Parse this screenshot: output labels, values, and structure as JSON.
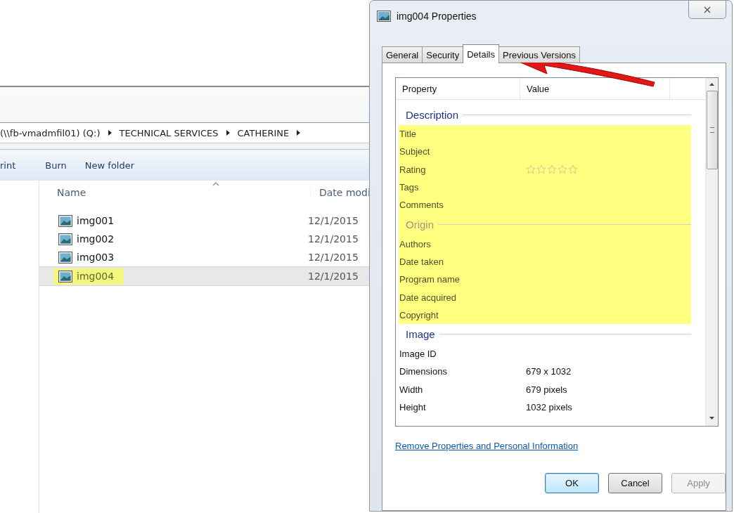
{
  "explorer": {
    "breadcrumb": [
      {
        "label": "(\\\\fb-vmadmfil01) (Q:)"
      },
      {
        "label": "TECHNICAL SERVICES"
      },
      {
        "label": "CATHERINE"
      }
    ],
    "toolbar": [
      "rint",
      "Burn",
      "New folder"
    ],
    "columns": [
      "Name",
      "Date modi"
    ],
    "files": [
      {
        "name": "img001",
        "date": "12/1/2015",
        "selected": false,
        "highlighted": false
      },
      {
        "name": "img002",
        "date": "12/1/2015",
        "selected": false,
        "highlighted": false
      },
      {
        "name": "img003",
        "date": "12/1/2015",
        "selected": false,
        "highlighted": false
      },
      {
        "name": "img004",
        "date": "12/1/2015",
        "selected": true,
        "highlighted": true
      }
    ]
  },
  "dialog": {
    "title": "img004 Properties",
    "tabs": [
      {
        "label": "General",
        "selected": false
      },
      {
        "label": "Security",
        "selected": false
      },
      {
        "label": "Details",
        "selected": true
      },
      {
        "label": "Previous Versions",
        "selected": false
      }
    ],
    "columns": [
      "Property",
      "Value"
    ],
    "groups": [
      {
        "heading": "Description",
        "highlighted": false,
        "rows": [
          {
            "kind": "text",
            "property": "Title",
            "highlighted": true
          },
          {
            "kind": "text",
            "property": "Subject",
            "highlighted": true
          },
          {
            "kind": "rating",
            "property": "Rating",
            "stars": 0,
            "highlighted": true
          },
          {
            "kind": "text",
            "property": "Tags",
            "highlighted": true
          },
          {
            "kind": "text",
            "property": "Comments",
            "highlighted": true
          }
        ]
      },
      {
        "heading": "Origin",
        "highlighted": true,
        "rows": [
          {
            "kind": "text",
            "property": "Authors",
            "highlighted": true
          },
          {
            "kind": "text",
            "property": "Date taken",
            "highlighted": true
          },
          {
            "kind": "text",
            "property": "Program name",
            "highlighted": true
          },
          {
            "kind": "text",
            "property": "Date acquired",
            "highlighted": true
          },
          {
            "kind": "text",
            "property": "Copyright",
            "highlighted": true
          }
        ]
      },
      {
        "heading": "Image",
        "highlighted": false,
        "rows": [
          {
            "kind": "text",
            "property": "Image ID",
            "highlighted": false
          },
          {
            "kind": "text",
            "property": "Dimensions",
            "value": "679 x 1032",
            "highlighted": false
          },
          {
            "kind": "text",
            "property": "Width",
            "value": "679 pixels",
            "highlighted": false
          },
          {
            "kind": "text",
            "property": "Height",
            "value": "1032 pixels",
            "highlighted": false
          }
        ]
      }
    ],
    "link": "Remove Properties and Personal Information",
    "buttons": [
      {
        "label": "OK",
        "default": true,
        "disabled": false
      },
      {
        "label": "Cancel",
        "default": false,
        "disabled": false
      },
      {
        "label": "Apply",
        "default": false,
        "disabled": true
      }
    ]
  }
}
